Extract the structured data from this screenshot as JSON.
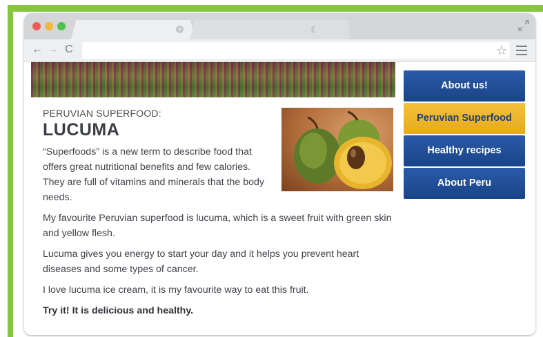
{
  "sidebar": {
    "items": [
      {
        "label": "About us!",
        "active": false
      },
      {
        "label": "Peruvian Superfood",
        "active": true
      },
      {
        "label": "Healthy recipes",
        "active": false
      },
      {
        "label": "About Peru",
        "active": false
      }
    ]
  },
  "article": {
    "kicker": "PERUVIAN SUPERFOOD:",
    "title": "LUCUMA",
    "paragraphs": [
      "“Superfoods” is a new term to describe food that offers great nutritional benefits and few calories. They are full of vitamins and minerals that the body needs.",
      "My favourite Peruvian superfood is lucuma, which is a sweet fruit with green skin and yellow flesh.",
      "Lucuma gives you energy to start your day and it helps you prevent heart diseases and some types of cancer.",
      "I love lucuma ice cream, it is my favourite way to eat this fruit.",
      "Try it! It is delicious and healthy."
    ]
  },
  "icons": {
    "close": "×",
    "back": "←",
    "forward": "→",
    "reload": "C",
    "star": "☆"
  },
  "colors": {
    "frame": "#86c542",
    "nav_blue": "#1f4a90",
    "nav_active": "#eab52a"
  }
}
